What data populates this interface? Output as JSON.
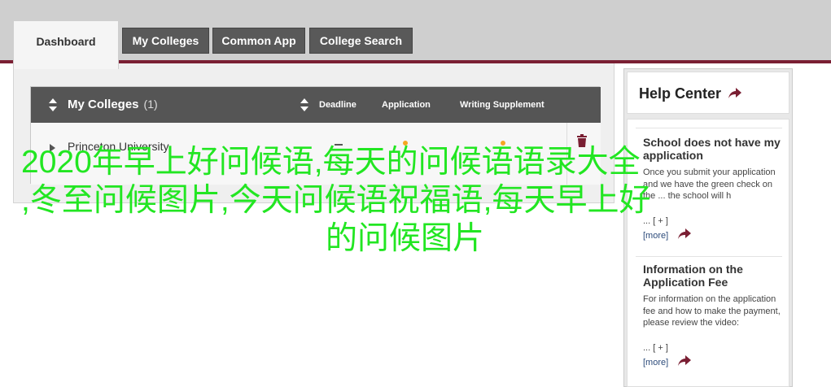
{
  "tabs": [
    {
      "label": "Dashboard",
      "active": true
    },
    {
      "label": "My Colleges",
      "active": false
    },
    {
      "label": "Common App",
      "active": false
    },
    {
      "label": "College Search",
      "active": false
    }
  ],
  "colors": {
    "maroon": "#7a1f33",
    "dark_gray": "#555555",
    "overlay_green": "#22e622",
    "status_dot": "#f5a623"
  },
  "colleges": {
    "title": "My Colleges",
    "count": "(1)",
    "columns": {
      "deadline": "Deadline",
      "application": "Application",
      "writing": "Writing Supplement"
    },
    "rows": [
      {
        "name": "Princeton University",
        "deadline": "–"
      }
    ]
  },
  "help": {
    "title": "Help Center",
    "articles": [
      {
        "title": "School does not have my application",
        "body": "Once you submit your application and we have the green check on the ... the school will h",
        "expand": "... [ + ]",
        "more": "[more]"
      },
      {
        "title": "Information on the Application Fee",
        "body": "For information on the application fee and how to make the payment, please review the video:",
        "expand": "... [ + ]",
        "more": "[more]"
      }
    ]
  },
  "overlay": {
    "line1": "2020年早上好问候语,每天的问候语语录大全",
    "line2": ",冬至问候图片,今天问候语祝福语,每天早上好",
    "line3": "的问候图片"
  }
}
